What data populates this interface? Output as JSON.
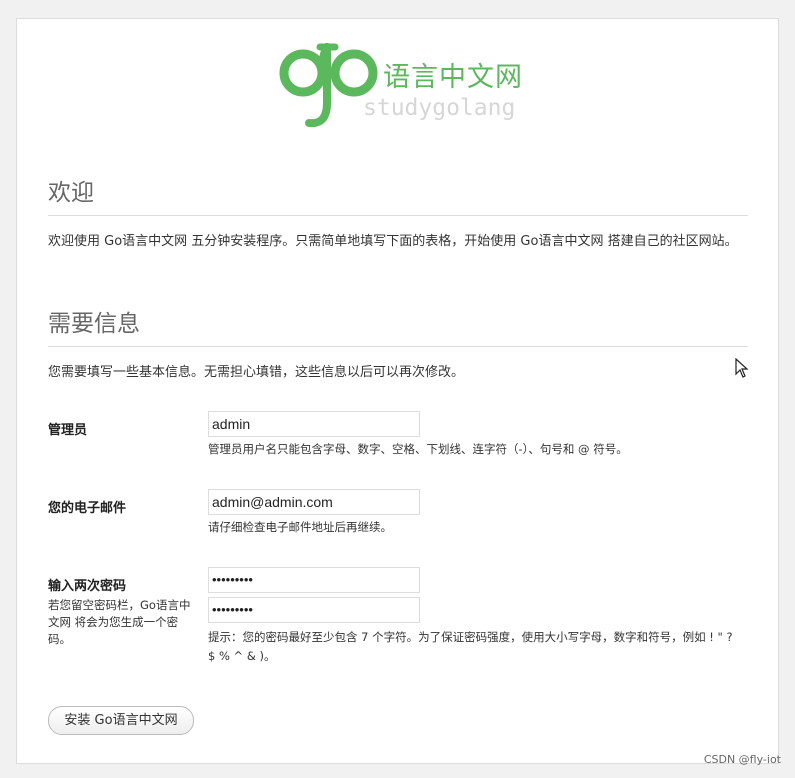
{
  "logo": {
    "cn_text": "语言中文网",
    "en_text": "studygolang",
    "color": "#5cb85c"
  },
  "welcome": {
    "heading": "欢迎",
    "text": "欢迎使用 Go语言中文网 五分钟安装程序。只需简单地填写下面的表格，开始使用 Go语言中文网 搭建自己的社区网站。"
  },
  "info": {
    "heading": "需要信息",
    "text": "您需要填写一些基本信息。无需担心填错，这些信息以后可以再次修改。"
  },
  "form": {
    "admin": {
      "label": "管理员",
      "value": "admin",
      "hint": "管理员用户名只能包含字母、数字、空格、下划线、连字符（-）、句号和 @ 符号。"
    },
    "email": {
      "label": "您的电子邮件",
      "value": "admin@admin.com",
      "hint": "请仔细检查电子邮件地址后再继续。"
    },
    "password": {
      "label": "输入两次密码",
      "note": "若您留空密码栏，Go语言中文网 将会为您生成一个密码。",
      "value1": "•••••••••",
      "value2": "•••••••••",
      "hint": "提示：您的密码最好至少包含 7 个字符。为了保证密码强度，使用大小写字母，数字和符号，例如 ! \" ? $ % ^ & )。"
    }
  },
  "install_button": "安装 Go语言中文网",
  "watermark": "CSDN @fly-iot",
  "icons": [
    "go-logo-icon",
    "mouse-cursor-icon"
  ]
}
